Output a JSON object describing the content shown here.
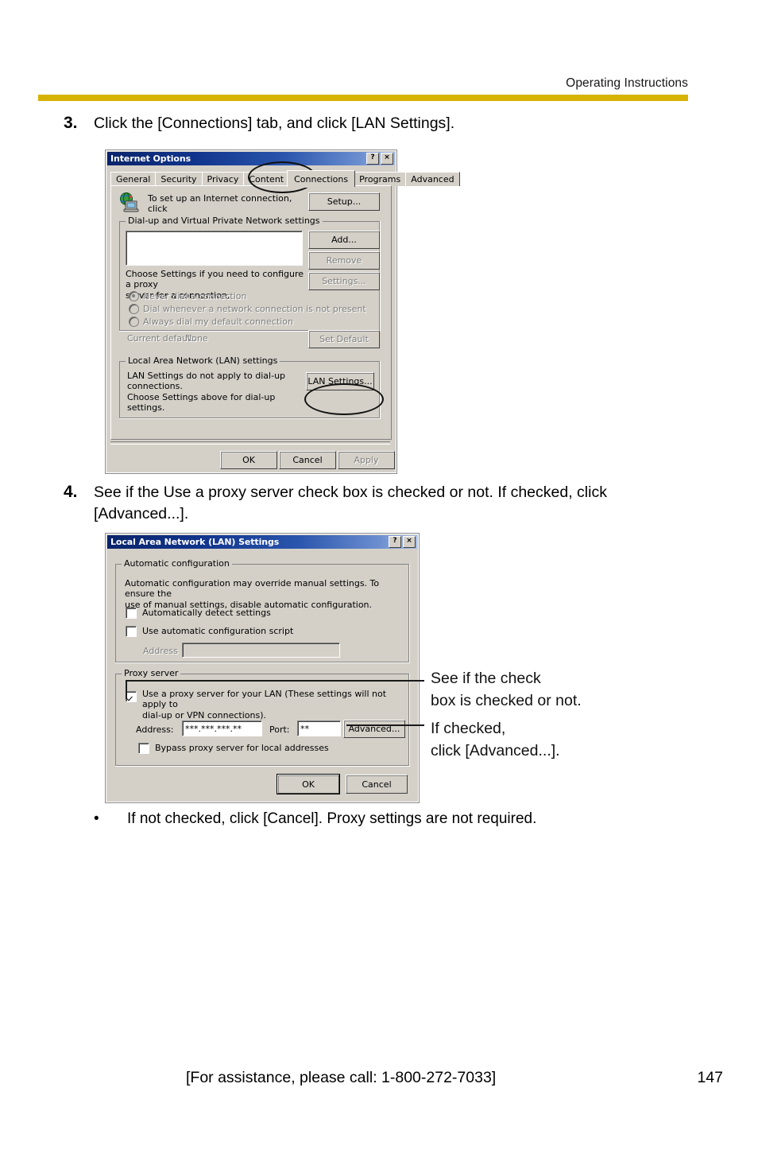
{
  "header": {
    "title": "Operating Instructions",
    "rule_color": "#d6b205"
  },
  "steps": [
    {
      "number": "3.",
      "text": "Click the [Connections] tab, and click [LAN Settings]."
    },
    {
      "number": "4.",
      "text": "See if the Use a proxy server check box is checked or not. If checked, click [Advanced...]."
    }
  ],
  "bullet": {
    "marker": "•",
    "text": "If not checked, click [Cancel]. Proxy settings are not required."
  },
  "internet_options": {
    "title": "Internet Options",
    "help_button": "?",
    "close_button": "×",
    "tabs": [
      {
        "label": "General",
        "active": false
      },
      {
        "label": "Security",
        "active": false
      },
      {
        "label": "Privacy",
        "active": false
      },
      {
        "label": "Content",
        "active": false
      },
      {
        "label": "Connections",
        "active": true
      },
      {
        "label": "Programs",
        "active": false
      },
      {
        "label": "Advanced",
        "active": false
      }
    ],
    "setup_text": "To set up an Internet connection, click\nSetup.",
    "setup_button": "Setup...",
    "dialup_group": "Dial-up and Virtual Private Network settings",
    "dialup_list_value": "",
    "add_button": "Add...",
    "remove_button": "Remove",
    "settings_button": "Settings...",
    "choose_settings_text": "Choose Settings if you need to configure a proxy\nserver for a connection.",
    "radios": [
      {
        "label": "Never dial a connection",
        "selected": true
      },
      {
        "label": "Dial whenever a network connection is not present",
        "selected": false
      },
      {
        "label": "Always dial my default connection",
        "selected": false
      }
    ],
    "current_default_label": "Current default:",
    "current_default_value": "None",
    "set_default_button": "Set Default",
    "lan_group": "Local Area Network (LAN) settings",
    "lan_text": "LAN Settings do not apply to dial-up connections.\nChoose Settings above for dial-up settings.",
    "lan_settings_button": "LAN Settings...",
    "ok_button": "OK",
    "cancel_button": "Cancel",
    "apply_button": "Apply"
  },
  "lan_settings": {
    "title": "Local Area Network (LAN) Settings",
    "help_button": "?",
    "close_button": "×",
    "auto_group": "Automatic configuration",
    "auto_text": "Automatic configuration may override manual settings.  To ensure the\nuse of manual settings, disable automatic configuration.",
    "auto_detect_label": "Automatically detect settings",
    "auto_detect_checked": false,
    "auto_script_label": "Use automatic configuration script",
    "auto_script_checked": false,
    "address_label_auto": "Address",
    "address_value_auto": "",
    "proxy_group": "Proxy server",
    "use_proxy_label": "Use a proxy server for your LAN (These settings will not apply to\ndial-up or VPN connections).",
    "use_proxy_checked": true,
    "address_label": "Address:",
    "address_value": "***.***.***.**",
    "port_label": "Port:",
    "port_value": "**",
    "advanced_button": "Advanced...",
    "bypass_label": "Bypass proxy server for local addresses",
    "bypass_checked": false,
    "ok_button": "OK",
    "cancel_button": "Cancel"
  },
  "annotations": [
    {
      "text": "See if the check\nbox is checked or not."
    },
    {
      "text": "If checked,\nclick [Advanced...]."
    }
  ],
  "footer": {
    "assistance": "[For assistance, please call: 1-800-272-7033]",
    "page_number": "147"
  }
}
